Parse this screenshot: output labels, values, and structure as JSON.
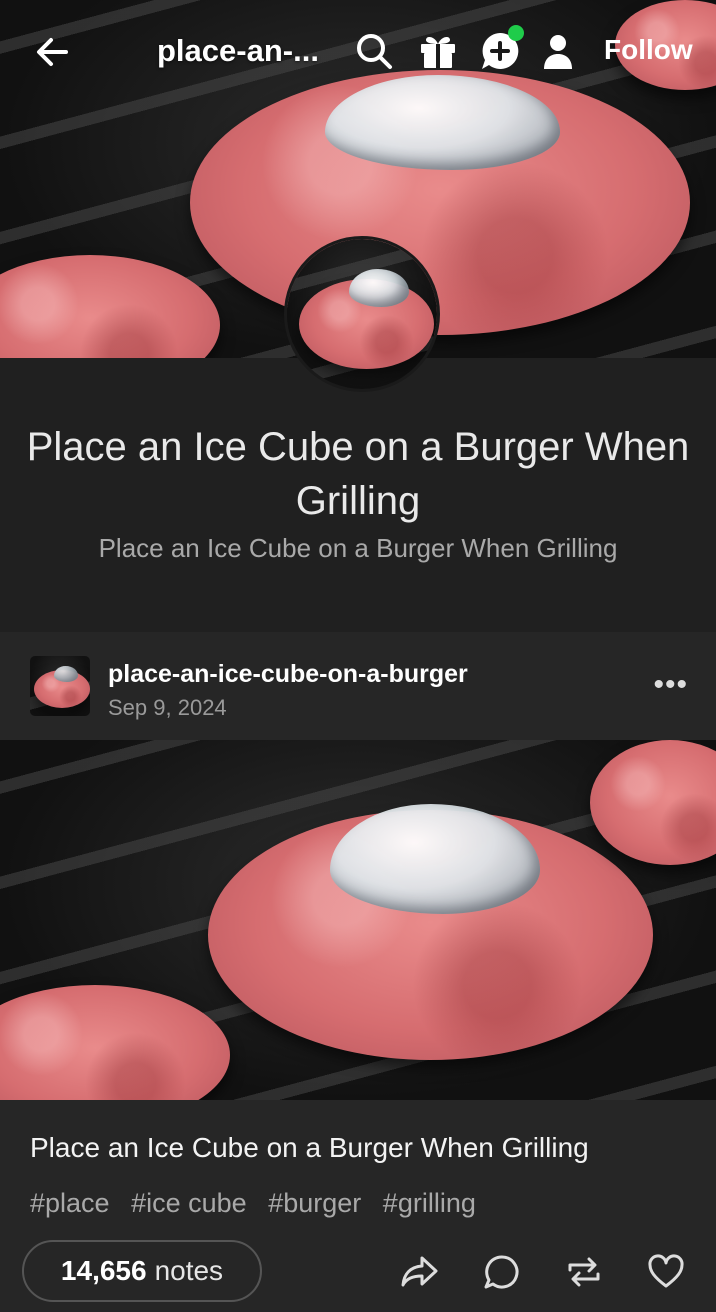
{
  "top_bar": {
    "title": "place-an-...",
    "follow_label": "Follow"
  },
  "blog_header": {
    "title": "Place an Ice Cube on a Burger When Grilling",
    "description": "Place an Ice Cube on a Burger When Grilling"
  },
  "post": {
    "blog_name": "place-an-ice-cube-on-a-burger",
    "date": "Sep 9, 2024",
    "more_label": "•••",
    "text": "Place an Ice Cube on a Burger When Grilling",
    "tags": [
      "#place",
      "#ice cube",
      "#burger",
      "#grilling"
    ],
    "notes_count": "14,656",
    "notes_label": "notes"
  },
  "colors": {
    "background": "#1a1a1a",
    "notification_dot": "#1fcc4a"
  },
  "icons": [
    "back-arrow-icon",
    "search-icon",
    "gift-icon",
    "compose-icon",
    "account-icon",
    "more-icon",
    "share-icon",
    "reply-icon",
    "reblog-icon",
    "like-icon"
  ]
}
